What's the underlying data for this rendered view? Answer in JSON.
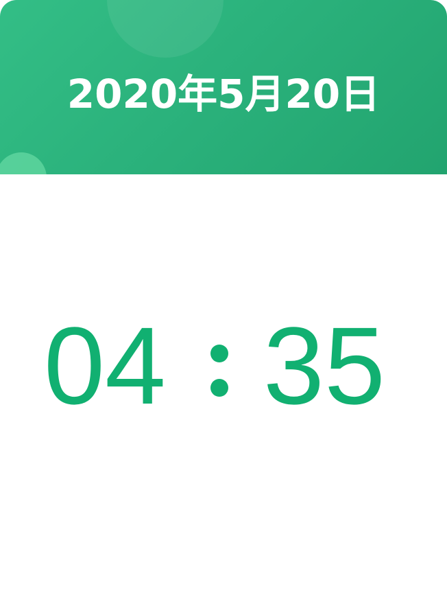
{
  "header": {
    "date": "2020年5月20日"
  },
  "clock": {
    "hours": "04",
    "minutes": "35"
  },
  "colors": {
    "header_green": "#2bb27c",
    "clock_green": "#11b071",
    "background": "#ffffff"
  }
}
